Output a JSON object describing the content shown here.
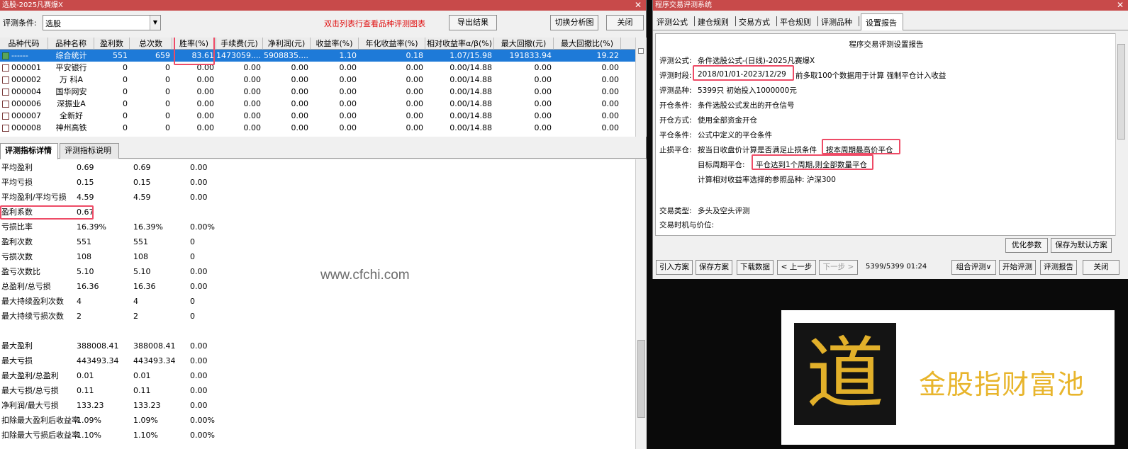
{
  "left": {
    "title": "选股-2025凡赛爆X",
    "condition_label": "评测条件:",
    "condition_value": "选股",
    "hint": "双击列表行查看品种评测图表",
    "export_btn": "导出结果",
    "switch_btn": "切换分析图",
    "close_btn": "关闭",
    "columns": [
      "品种代码",
      "品种名称",
      "盈利数",
      "总次数",
      "胜率(%)",
      "手续费(元)",
      "净利润(元)",
      "收益率(%)",
      "年化收益率(%)",
      "相对收益率α/β(%)",
      "最大回撤(元)",
      "最大回撤比(%)"
    ],
    "rows": [
      [
        "------",
        "综合统计",
        "551",
        "659",
        "83.61",
        "1473059....",
        "5908835....",
        "1.10",
        "0.18",
        "1.07/15.98",
        "191833.94",
        "19.22"
      ],
      [
        "000001",
        "平安银行",
        "0",
        "0",
        "0.00",
        "0.00",
        "0.00",
        "0.00",
        "0.00",
        "0.00/14.88",
        "0.00",
        "0.00"
      ],
      [
        "000002",
        "万 科A",
        "0",
        "0",
        "0.00",
        "0.00",
        "0.00",
        "0.00",
        "0.00",
        "0.00/14.88",
        "0.00",
        "0.00"
      ],
      [
        "000004",
        "国华网安",
        "0",
        "0",
        "0.00",
        "0.00",
        "0.00",
        "0.00",
        "0.00",
        "0.00/14.88",
        "0.00",
        "0.00"
      ],
      [
        "000006",
        "深振业A",
        "0",
        "0",
        "0.00",
        "0.00",
        "0.00",
        "0.00",
        "0.00",
        "0.00/14.88",
        "0.00",
        "0.00"
      ],
      [
        "000007",
        "全新好",
        "0",
        "0",
        "0.00",
        "0.00",
        "0.00",
        "0.00",
        "0.00",
        "0.00/14.88",
        "0.00",
        "0.00"
      ],
      [
        "000008",
        "神州高铁",
        "0",
        "0",
        "0.00",
        "0.00",
        "0.00",
        "0.00",
        "0.00",
        "0.00/14.88",
        "0.00",
        "0.00"
      ]
    ],
    "tabs": [
      "评测指标详情",
      "评测指标说明"
    ],
    "stats": [
      [
        "平均盈利",
        "0.69",
        "0.69",
        "0.00"
      ],
      [
        "平均亏损",
        "0.15",
        "0.15",
        "0.00"
      ],
      [
        "平均盈利/平均亏损",
        "4.59",
        "4.59",
        "0.00"
      ],
      [
        "盈利系数",
        "0.67",
        "",
        ""
      ],
      [
        "亏损比率",
        "16.39%",
        "16.39%",
        "0.00%"
      ],
      [
        "盈利次数",
        "551",
        "551",
        "0"
      ],
      [
        "亏损次数",
        "108",
        "108",
        "0"
      ],
      [
        "盈亏次数比",
        "5.10",
        "5.10",
        "0.00"
      ],
      [
        "总盈利/总亏损",
        "16.36",
        "16.36",
        "0.00"
      ],
      [
        "最大持续盈利次数",
        "4",
        "4",
        "0"
      ],
      [
        "最大持续亏损次数",
        "2",
        "2",
        "0"
      ],
      [
        "",
        "",
        "",
        ""
      ],
      [
        "最大盈利",
        "388008.41",
        "388008.41",
        "0.00"
      ],
      [
        "最大亏损",
        "443493.34",
        "443493.34",
        "0.00"
      ],
      [
        "最大盈利/总盈利",
        "0.01",
        "0.01",
        "0.00"
      ],
      [
        "最大亏损/总亏损",
        "0.11",
        "0.11",
        "0.00"
      ],
      [
        "净利润/最大亏损",
        "133.23",
        "133.23",
        "0.00"
      ],
      [
        "扣除最大盈利后收益率",
        "1.09%",
        "1.09%",
        "0.00%"
      ],
      [
        "扣除最大亏损后收益率",
        "1.10%",
        "1.10%",
        "0.00%"
      ]
    ]
  },
  "watermark": "www.cfchi.com",
  "right": {
    "title": "程序交易评测系统",
    "tabs": [
      "评测公式",
      "建仓规则",
      "交易方式",
      "平仓规则",
      "评测品种",
      "设置报告"
    ],
    "report_title": "程序交易评测设置报告",
    "formula_label": "评测公式:",
    "formula_value": "条件选股公式-(日线)-2025凡赛爆X",
    "period_label": "评测时段:",
    "period_range": "2018/01/01-2023/12/29",
    "period_note": "前多取100个数据用于计算 强制平仓计入收益",
    "variety_label": "评测品种:",
    "variety_value": "5399只 初始投入1000000元",
    "open_cond_label": "开仓条件:",
    "open_cond_value": "条件选股公式发出的开仓信号",
    "open_mode_label": "开仓方式:",
    "open_mode_value": "使用全部资金开仓",
    "close_cond_label": "平仓条件:",
    "close_cond_value": "公式中定义的平仓条件",
    "stop_label": "止损平仓:",
    "stop_value": "按当日收盘价计算是否满足止损条件",
    "stop_highlight": "按本周期最高价平仓",
    "target_label": "目标周期平仓:",
    "target_value": "平仓达到1个周期,则全部数量平仓",
    "bench_text": "计算相对收益率选择的参照品种: 沪深300",
    "trade_type_label": "交易类型:",
    "trade_type_value": "多头及空头评测",
    "trade_time_label": "交易时机与价位:",
    "optimize_btn": "优化参数",
    "save_default_btn": "保存为默认方案",
    "bottom_buttons": [
      "引入方案",
      "保存方案",
      "下载数据",
      "< 上一步",
      "下一步 >"
    ],
    "progress": "5399/5399 01:24",
    "combo_btn": "组合评测∨",
    "start_btn": "开始评测",
    "report_btn": "评测报告",
    "close_btn": "关闭"
  },
  "ad": {
    "seal_char": "道",
    "brand": "金股指财富池",
    "brand_color": "#e8b52c"
  },
  "colors": {
    "title_bar": "#c84a4a",
    "selection": "#1e7ad8",
    "highlight_box": "#ee4b66",
    "hint_text": "#e01010"
  }
}
